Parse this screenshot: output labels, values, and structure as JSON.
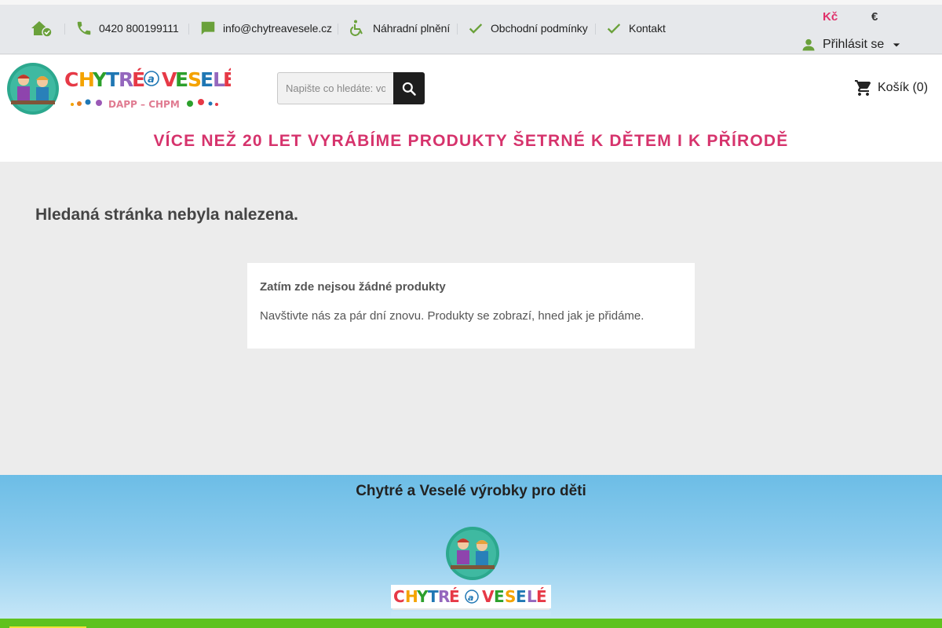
{
  "topbar": {
    "phone": "0420 800199111",
    "email": "info@chytreavesele.cz",
    "replacement": "Náhradní plnění",
    "terms": "Obchodní podmínky",
    "contact": "Kontakt",
    "currencies": [
      "Kč",
      "€"
    ],
    "login": "Přihlásit se"
  },
  "header": {
    "logo_text": "CHYTRÉ a VESELÉ",
    "logo_subtext": "DAPP – CHPM",
    "search_placeholder": "Napište co hledáte: vo",
    "cart": "Košík (0)",
    "slogan": "VÍCE NEŽ 20 LET VYRÁBÍME PRODUKTY ŠETRNÉ K DĚTEM I K PŘÍRODĚ"
  },
  "main": {
    "title": "Hledaná stránka nebyla nalezena.",
    "notice_title": "Zatím zde nejsou žádné produkty",
    "notice_text": "Navštivte nás za pár dní znovu. Produkty se zobrazí, hned jak je přidáme."
  },
  "footer": {
    "title": "Chytré a Veselé výrobky pro děti"
  },
  "colors": {
    "icon_green": "#6aa13a",
    "accent_pink": "#d6336c",
    "footer_blue": "#6cbde6",
    "bottom_green": "#5fc21f"
  }
}
